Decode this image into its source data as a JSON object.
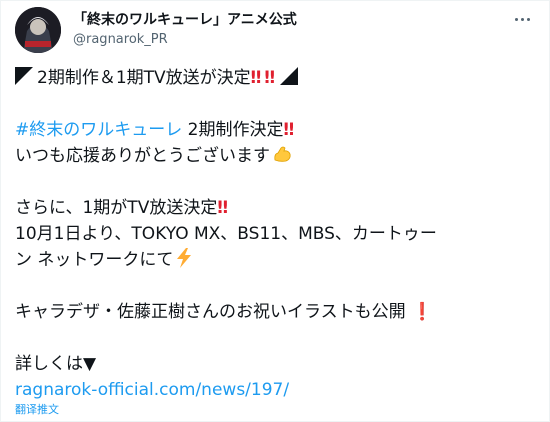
{
  "author": {
    "display_name": "「終末のワルキューレ」アニメ公式",
    "handle": "@ragnarok_PR"
  },
  "icons": {
    "avatar": "account-avatar",
    "more": "more-horizontal-icon",
    "double_exclamation": "double-exclamation-emoji",
    "flexed_biceps": "flexed-biceps-emoji",
    "high_voltage": "high-voltage-emoji",
    "exclamation": "exclamation-emoji",
    "corner_triangle": "black-corner-triangle"
  },
  "colors": {
    "link": "#1d9bf0",
    "text": "#0f1419",
    "secondary": "#536471",
    "emoji_red": "#e0202f",
    "emoji_yellow": "#ffc83d"
  },
  "tweet": {
    "line1": "2期制作＆1期TV放送が決定",
    "hashtag": "#終末のワルキューレ",
    "line2_rest": " 2期制作決定",
    "line3": "いつも応援ありがとうございます",
    "line4": "さらに、1期がTV放送決定",
    "line5": "10月1日より、TOKYO MX、BS11、MBS、カートゥー",
    "line6": "ン ネットワークにて",
    "line7": "キャラデザ・佐藤正樹さんのお祝いイラストも公開",
    "line8": "詳しくは▼",
    "url": "ragnarok-official.com/news/197/"
  },
  "translate_label": "翻译推文"
}
